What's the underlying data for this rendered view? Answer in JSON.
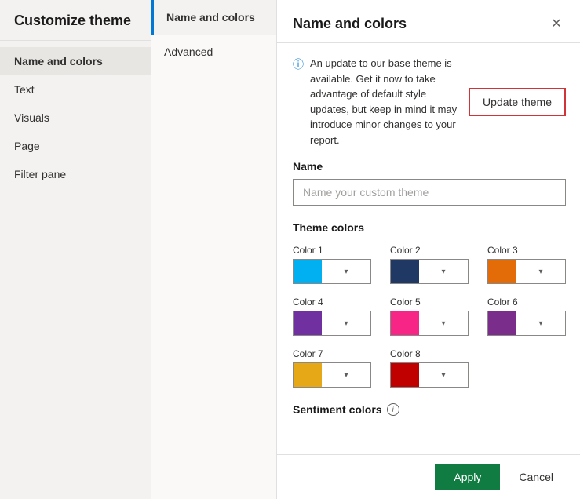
{
  "sidebar": {
    "title": "Customize theme",
    "nav_items": [
      {
        "id": "name-and-colors",
        "label": "Name and colors",
        "active": true
      },
      {
        "id": "text",
        "label": "Text",
        "active": false
      },
      {
        "id": "visuals",
        "label": "Visuals",
        "active": false
      },
      {
        "id": "page",
        "label": "Page",
        "active": false
      },
      {
        "id": "filter-pane",
        "label": "Filter pane",
        "active": false
      }
    ]
  },
  "middle_panel": {
    "tabs": [
      {
        "id": "name-and-colors",
        "label": "Name and colors",
        "active": true
      },
      {
        "id": "advanced",
        "label": "Advanced",
        "active": false
      }
    ]
  },
  "main": {
    "header": {
      "title": "Name and colors",
      "close_label": "✕"
    },
    "info_banner": {
      "text": "An update to our base theme is available. Get it now to take advantage of default style updates, but keep in mind it may introduce minor changes to your report."
    },
    "update_theme_button": "Update theme",
    "name_section": {
      "label": "Name",
      "placeholder": "Name your custom theme"
    },
    "theme_colors": {
      "label": "Theme colors",
      "colors": [
        {
          "id": "color1",
          "label": "Color 1",
          "hex": "#00B0F0"
        },
        {
          "id": "color2",
          "label": "Color 2",
          "hex": "#1F3864"
        },
        {
          "id": "color3",
          "label": "Color 3",
          "hex": "#E36C09"
        },
        {
          "id": "color4",
          "label": "Color 4",
          "hex": "#7030A0"
        },
        {
          "id": "color5",
          "label": "Color 5",
          "hex": "#F72585"
        },
        {
          "id": "color6",
          "label": "Color 6",
          "hex": "#7B2D8B"
        },
        {
          "id": "color7",
          "label": "Color 7",
          "hex": "#E6A817"
        },
        {
          "id": "color8",
          "label": "Color 8",
          "hex": "#C00000"
        }
      ]
    },
    "sentiment_colors": {
      "label": "Sentiment colors"
    },
    "footer": {
      "apply_label": "Apply",
      "cancel_label": "Cancel"
    }
  }
}
